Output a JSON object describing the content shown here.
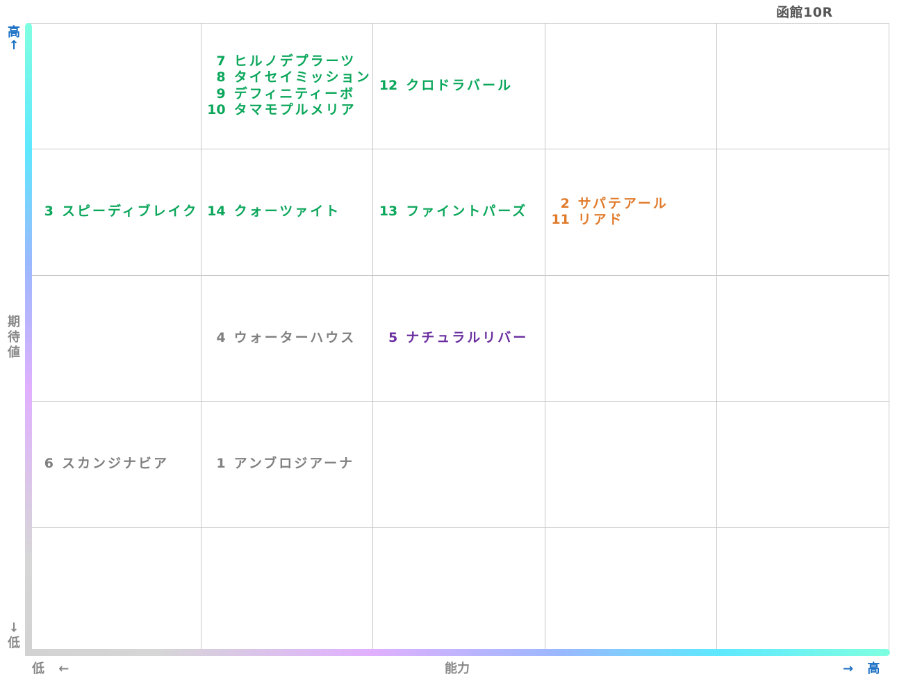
{
  "title": "函館10R",
  "y_axis": {
    "label": "期待値",
    "high": "高",
    "low": "低",
    "up_arrow": "↑",
    "down_arrow": "↓"
  },
  "x_axis": {
    "label": "能力",
    "low": "低",
    "high": "高",
    "left_arrow": "←",
    "right_arrow": "→"
  },
  "colors": {
    "green": "#0aa65a",
    "orange": "#e07b2c",
    "purple": "#6b2fa0",
    "grey": "#808080",
    "axis_label": "#1a6fc4"
  },
  "chart_data": {
    "type": "table",
    "x_label": "能力",
    "y_label": "期待値",
    "grid": {
      "columns": 5,
      "rows": 5
    },
    "cells": [
      {
        "col": 2,
        "row": 1,
        "horses": [
          {
            "num": "7",
            "name": "ヒルノデプラーツ",
            "color": "green"
          },
          {
            "num": "8",
            "name": "タイセイミッション",
            "color": "green"
          },
          {
            "num": "9",
            "name": "デフィニティーボ",
            "color": "green"
          },
          {
            "num": "10",
            "name": "タマモプルメリア",
            "color": "green"
          }
        ]
      },
      {
        "col": 3,
        "row": 1,
        "horses": [
          {
            "num": "12",
            "name": "クロドラバール",
            "color": "green"
          }
        ]
      },
      {
        "col": 1,
        "row": 2,
        "horses": [
          {
            "num": "3",
            "name": "スピーディブレイク",
            "color": "green"
          }
        ]
      },
      {
        "col": 2,
        "row": 2,
        "horses": [
          {
            "num": "14",
            "name": "クォーツァイト",
            "color": "green"
          }
        ]
      },
      {
        "col": 3,
        "row": 2,
        "horses": [
          {
            "num": "13",
            "name": "ファイントパーズ",
            "color": "green"
          }
        ]
      },
      {
        "col": 4,
        "row": 2,
        "horses": [
          {
            "num": "2",
            "name": "サパテアール",
            "color": "orange"
          },
          {
            "num": "11",
            "name": "リアド",
            "color": "orange"
          }
        ]
      },
      {
        "col": 2,
        "row": 3,
        "horses": [
          {
            "num": "4",
            "name": "ウォーターハウス",
            "color": "grey"
          }
        ]
      },
      {
        "col": 3,
        "row": 3,
        "horses": [
          {
            "num": "5",
            "name": "ナチュラルリバー",
            "color": "purple"
          }
        ]
      },
      {
        "col": 1,
        "row": 4,
        "horses": [
          {
            "num": "6",
            "name": "スカンジナビア",
            "color": "grey"
          }
        ]
      },
      {
        "col": 2,
        "row": 4,
        "horses": [
          {
            "num": "1",
            "name": "アンブロジアーナ",
            "color": "grey"
          }
        ]
      }
    ]
  }
}
